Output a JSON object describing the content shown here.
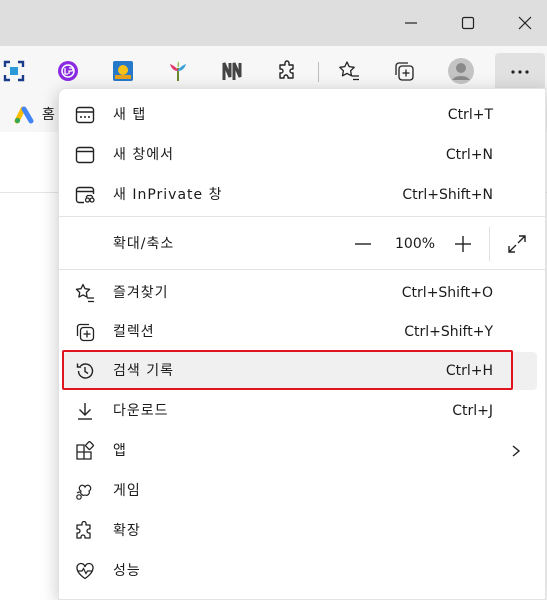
{
  "window": {
    "minimize_icon": "minimize-icon",
    "maximize_icon": "maximize-icon",
    "close_icon": "close-icon"
  },
  "favbar": {
    "home_label": "홈"
  },
  "menu": {
    "new_tab": {
      "label": "새 탭",
      "shortcut": "Ctrl+T"
    },
    "new_window": {
      "label": "새 창에서",
      "shortcut": "Ctrl+N"
    },
    "new_inprivate": {
      "label": "새 InPrivate 창",
      "shortcut": "Ctrl+Shift+N"
    },
    "zoom": {
      "label": "확대/축소",
      "minus": "—",
      "value": "100%",
      "plus": "+"
    },
    "favorites": {
      "label": "즐겨찾기",
      "shortcut": "Ctrl+Shift+O"
    },
    "collections": {
      "label": "컬렉션",
      "shortcut": "Ctrl+Shift+Y"
    },
    "history": {
      "label": "검색 기록",
      "shortcut": "Ctrl+H"
    },
    "downloads": {
      "label": "다운로드",
      "shortcut": "Ctrl+J"
    },
    "apps": {
      "label": "앱"
    },
    "games": {
      "label": "게임"
    },
    "extensions": {
      "label": "확장"
    },
    "performance": {
      "label": "성능"
    }
  },
  "colors": {
    "highlight_border": "#e0141e",
    "menu_bg": "#ffffff",
    "titlebar_bg": "#dedede"
  }
}
